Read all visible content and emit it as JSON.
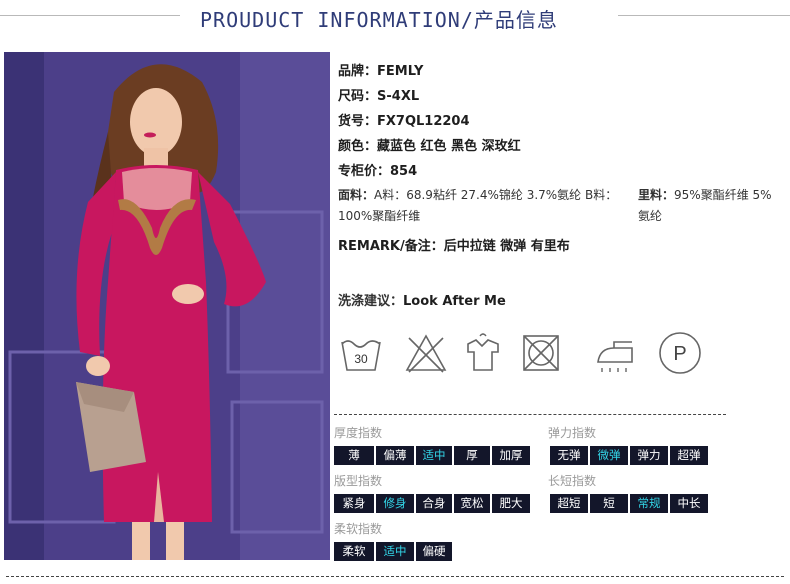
{
  "header": {
    "title": "PROUDUCT INFORMATION/产品信息"
  },
  "specs": {
    "brand": {
      "label": "品牌：",
      "value": "FEMLY"
    },
    "size": {
      "label": "尺码：",
      "value": "S-4XL"
    },
    "item_no": {
      "label": "货号：",
      "value": "FX7QL12204"
    },
    "color": {
      "label": "颜色：",
      "value": "藏蓝色 红色 黑色 深玫红"
    },
    "price": {
      "label": "专柜价：",
      "value": "854"
    },
    "fabric": {
      "label": "面料：",
      "value": "A料：68.9粘纤 27.4%锦纶 3.7%氨纶 B料：100%聚酯纤维"
    },
    "lining": {
      "label": "里料：",
      "value": "95%聚酯纤维 5%氨纶"
    },
    "remark": {
      "label": "REMARK/备注：",
      "value": "后中拉链 微弹 有里布"
    }
  },
  "wash": {
    "label": "洗涤建议：",
    "value": "Look After Me"
  },
  "care_icons": [
    {
      "name": "wash-30-icon",
      "text": "30"
    },
    {
      "name": "no-bleach-icon"
    },
    {
      "name": "hang-dry-icon"
    },
    {
      "name": "no-tumble-dry-icon"
    },
    {
      "name": "iron-icon"
    },
    {
      "name": "dry-clean-p-icon",
      "text": "P"
    }
  ],
  "indices": {
    "thickness": {
      "title": "厚度指数",
      "options": [
        "薄",
        "偏薄",
        "适中",
        "厚",
        "加厚"
      ],
      "selected": "适中"
    },
    "elasticity": {
      "title": "弹力指数",
      "options": [
        "无弹",
        "微弹",
        "弹力",
        "超弹"
      ],
      "selected": "微弹"
    },
    "fit": {
      "title": "版型指数",
      "options": [
        "紧身",
        "修身",
        "合身",
        "宽松",
        "肥大"
      ],
      "selected": "修身"
    },
    "length": {
      "title": "长短指数",
      "options": [
        "超短",
        "短",
        "常规",
        "中长"
      ],
      "selected": "常规"
    },
    "softness": {
      "title": "柔软指数",
      "options": [
        "柔软",
        "适中",
        "偏硬"
      ],
      "selected": "适中"
    }
  },
  "colors": {
    "title": "#2f3c78",
    "chip_bg": "#13162a",
    "chip_selected_text": "#33d6e8",
    "dress": "#c8175f",
    "backdrop": "#4a3f86"
  }
}
